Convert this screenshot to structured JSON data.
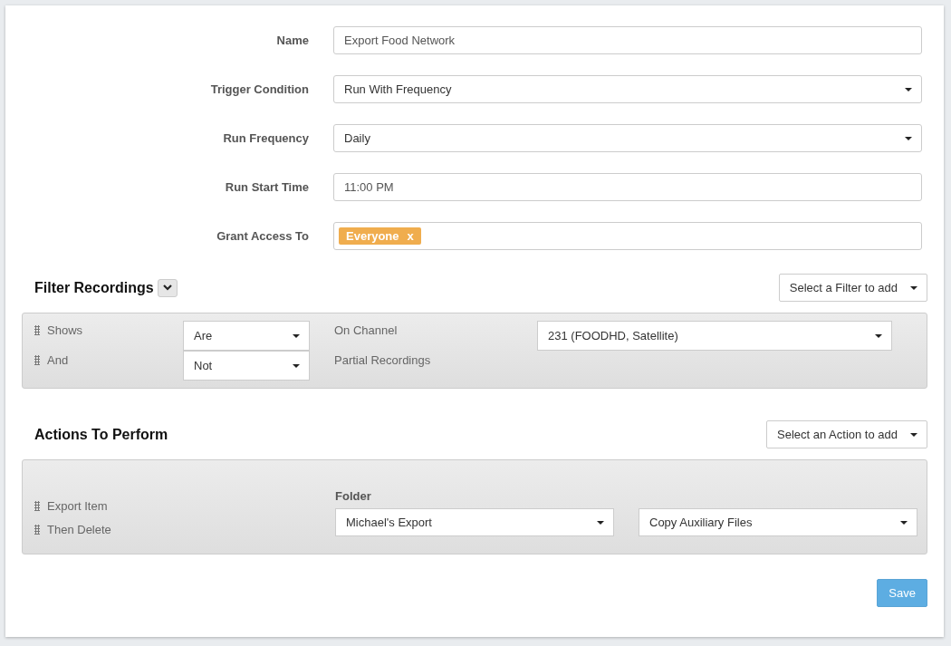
{
  "form": {
    "fields": [
      {
        "label": "Name",
        "kind": "text",
        "value": "Export Food Network"
      },
      {
        "label": "Trigger Condition",
        "kind": "select",
        "value": "Run With Frequency"
      },
      {
        "label": "Run Frequency",
        "kind": "select",
        "value": "Daily"
      },
      {
        "label": "Run Start Time",
        "kind": "text",
        "value": "11:00 PM"
      },
      {
        "label": "Grant Access To",
        "kind": "tags",
        "tags": [
          {
            "text": "Everyone",
            "remove": "x"
          }
        ]
      }
    ]
  },
  "filter_section": {
    "title": "Filter Recordings",
    "add_select": "Select a Filter to add",
    "rows": [
      {
        "label": "Shows",
        "operator": "Are",
        "condition": "On Channel",
        "value": "231 (FOODHD, Satellite)"
      },
      {
        "label": "And",
        "operator": "Not",
        "condition": "Partial Recordings"
      }
    ]
  },
  "actions_section": {
    "title": "Actions To Perform",
    "add_select": "Select an Action to add",
    "items": [
      "Export Item",
      "Then Delete"
    ],
    "folder_label": "Folder",
    "folder": "Michael's Export",
    "option": "Copy Auxiliary Files"
  },
  "save_button": {
    "label": "Save",
    "disabled": true
  }
}
